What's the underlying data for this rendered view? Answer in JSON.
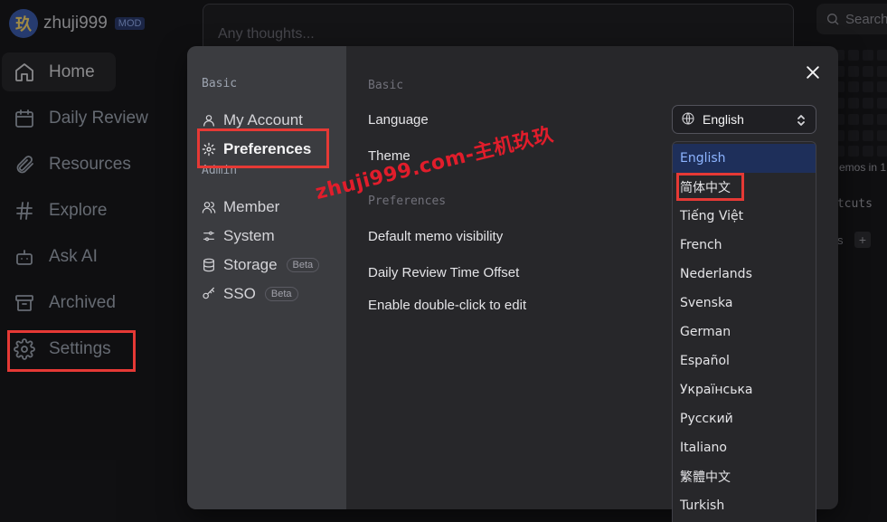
{
  "app": {
    "brand_logo_char": "玖",
    "brand_name": "zhuji999",
    "brand_badge": "MOD",
    "nav": [
      {
        "label": "Home",
        "icon": "home-icon"
      },
      {
        "label": "Daily Review",
        "icon": "calendar-icon"
      },
      {
        "label": "Resources",
        "icon": "paperclip-icon"
      },
      {
        "label": "Explore",
        "icon": "hash-icon"
      },
      {
        "label": "Ask AI",
        "icon": "bot-icon"
      },
      {
        "label": "Archived",
        "icon": "archive-icon"
      },
      {
        "label": "Settings",
        "icon": "gear-icon"
      }
    ],
    "editor_placeholder": "Any thoughts...",
    "search_label": "Search",
    "bg_stat_text": "emos in 1",
    "bg_shortcuts_text": "rtcuts",
    "bg_tags_text": "s"
  },
  "modal": {
    "sidebar": {
      "basic_heading": "Basic",
      "basic_items": [
        {
          "label": "My Account",
          "icon": "user-icon"
        },
        {
          "label": "Preferences",
          "icon": "gear-icon"
        }
      ],
      "admin_heading": "Admin",
      "admin_items": [
        {
          "label": "Member",
          "icon": "users-icon",
          "badge": ""
        },
        {
          "label": "System",
          "icon": "sliders-icon",
          "badge": ""
        },
        {
          "label": "Storage",
          "icon": "database-icon",
          "badge": "Beta"
        },
        {
          "label": "SSO",
          "icon": "key-icon",
          "badge": "Beta"
        }
      ]
    },
    "main": {
      "basic_heading": "Basic",
      "language_label": "Language",
      "theme_label": "Theme",
      "preferences_heading": "Preferences",
      "default_visibility_label": "Default memo visibility",
      "daily_review_offset_label": "Daily Review Time Offset",
      "double_click_label": "Enable double-click to edit",
      "language_value": "English"
    },
    "language_options": [
      "English",
      "简体中文",
      "Tiếng Việt",
      "French",
      "Nederlands",
      "Svenska",
      "German",
      "Español",
      "Українська",
      "Русский",
      "Italiano",
      "繁體中文",
      "Turkish"
    ],
    "selected_option": "English"
  },
  "watermark": "zhuji999.com-主机玖玖",
  "colors": {
    "background": "#18181b",
    "modal_bg": "#27272a",
    "modal_sidebar_bg": "#3b3c40",
    "highlight_box": "#e53935",
    "selected_option_bg": "#1e2f5a",
    "selected_option_text": "#8db4ff"
  }
}
